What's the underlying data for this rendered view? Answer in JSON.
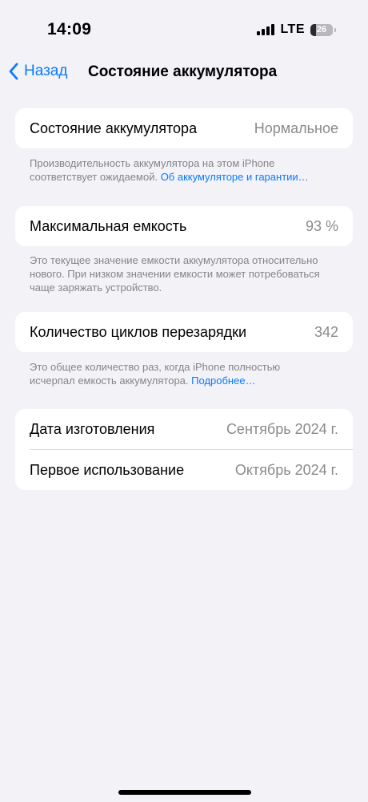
{
  "status_bar": {
    "time": "14:09",
    "network": "LTE",
    "battery_percent": "26",
    "battery_level": 0.26
  },
  "nav": {
    "back_label": "Назад",
    "title": "Состояние аккумулятора"
  },
  "health": {
    "label": "Состояние аккумулятора",
    "value": "Нормальное",
    "footnote": "Производительность аккумулятора на этом iPhone соответствует ожидаемой.",
    "footnote_link": "Об аккумуляторе и гарантии…"
  },
  "capacity": {
    "label": "Максимальная емкость",
    "value": "93 %",
    "footnote": "Это текущее значение емкости аккумулятора относительно нового. При низком значении емкости может потребоваться чаще заряжать устройство."
  },
  "cycles": {
    "label": "Количество циклов перезарядки",
    "value": "342",
    "footnote": "Это общее количество раз, когда iPhone полностью исчерпал емкость аккумулятора.",
    "footnote_link": "Подробнее…"
  },
  "dates": {
    "manufacture_label": "Дата изготовления",
    "manufacture_value": "Сентябрь 2024 г.",
    "first_use_label": "Первое использование",
    "first_use_value": "Октябрь 2024 г."
  }
}
